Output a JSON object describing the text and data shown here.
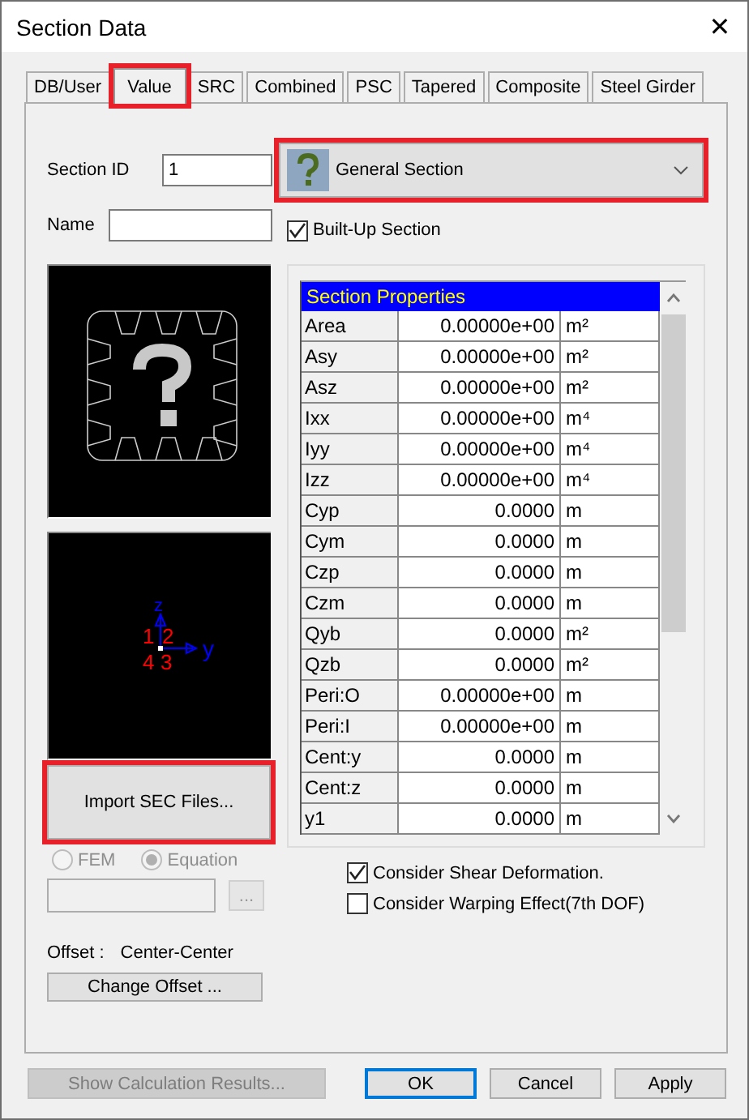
{
  "window": {
    "title": "Section Data",
    "close": "✕"
  },
  "tabs": [
    {
      "label": "DB/User",
      "selected": false,
      "highlighted": false
    },
    {
      "label": "Value",
      "selected": true,
      "highlighted": true
    },
    {
      "label": "SRC",
      "selected": false,
      "highlighted": false
    },
    {
      "label": "Combined",
      "selected": false,
      "highlighted": false
    },
    {
      "label": "PSC",
      "selected": false,
      "highlighted": false
    },
    {
      "label": "Tapered",
      "selected": false,
      "highlighted": false
    },
    {
      "label": "Composite",
      "selected": false,
      "highlighted": false
    },
    {
      "label": "Steel Girder",
      "selected": false,
      "highlighted": false
    }
  ],
  "section_id": {
    "label": "Section ID",
    "value": "1"
  },
  "section_type": {
    "value": "General Section",
    "highlighted": true
  },
  "name": {
    "label": "Name"
  },
  "built_up": {
    "label": "Built-Up Section",
    "checked": true
  },
  "axis_preview": {
    "axis_labels": [
      "z",
      "y"
    ],
    "corner_numbers": [
      "1",
      "2",
      "4",
      "3"
    ]
  },
  "import_button": {
    "label": "Import SEC Files...",
    "highlighted": true
  },
  "method_radios": [
    {
      "label": "FEM",
      "selected": false,
      "disabled": true
    },
    {
      "label": "Equation",
      "selected": true,
      "disabled": true
    }
  ],
  "browse_button": {
    "label": "...",
    "disabled": true
  },
  "offset": {
    "label": "Offset :",
    "value": "Center-Center",
    "button": "Change Offset ..."
  },
  "properties": {
    "title": "Section Properties",
    "rows": [
      {
        "name": "Area",
        "value": "0.00000e+00",
        "unit": "m²"
      },
      {
        "name": "Asy",
        "value": "0.00000e+00",
        "unit": "m²"
      },
      {
        "name": "Asz",
        "value": "0.00000e+00",
        "unit": "m²"
      },
      {
        "name": "Ixx",
        "value": "0.00000e+00",
        "unit": "m⁴"
      },
      {
        "name": "Iyy",
        "value": "0.00000e+00",
        "unit": "m⁴"
      },
      {
        "name": "Izz",
        "value": "0.00000e+00",
        "unit": "m⁴"
      },
      {
        "name": "Cyp",
        "value": "0.0000",
        "unit": "m"
      },
      {
        "name": "Cym",
        "value": "0.0000",
        "unit": "m"
      },
      {
        "name": "Czp",
        "value": "0.0000",
        "unit": "m"
      },
      {
        "name": "Czm",
        "value": "0.0000",
        "unit": "m"
      },
      {
        "name": "Qyb",
        "value": "0.0000",
        "unit": "m²"
      },
      {
        "name": "Qzb",
        "value": "0.0000",
        "unit": "m²"
      },
      {
        "name": "Peri:O",
        "value": "0.00000e+00",
        "unit": "m"
      },
      {
        "name": "Peri:I",
        "value": "0.00000e+00",
        "unit": "m"
      },
      {
        "name": "Cent:y",
        "value": "0.0000",
        "unit": "m"
      },
      {
        "name": "Cent:z",
        "value": "0.0000",
        "unit": "m"
      },
      {
        "name": "y1",
        "value": "0.0000",
        "unit": "m"
      }
    ]
  },
  "options": [
    {
      "label": "Consider Shear Deformation.",
      "checked": true
    },
    {
      "label": "Consider Warping Effect(7th DOF)",
      "checked": false
    }
  ],
  "footer_buttons": [
    {
      "label": "Show Calculation Results...",
      "disabled": true,
      "default": false
    },
    {
      "label": "OK",
      "disabled": false,
      "default": true
    },
    {
      "label": "Cancel",
      "disabled": false,
      "default": false
    },
    {
      "label": "Apply",
      "disabled": false,
      "default": false
    }
  ]
}
